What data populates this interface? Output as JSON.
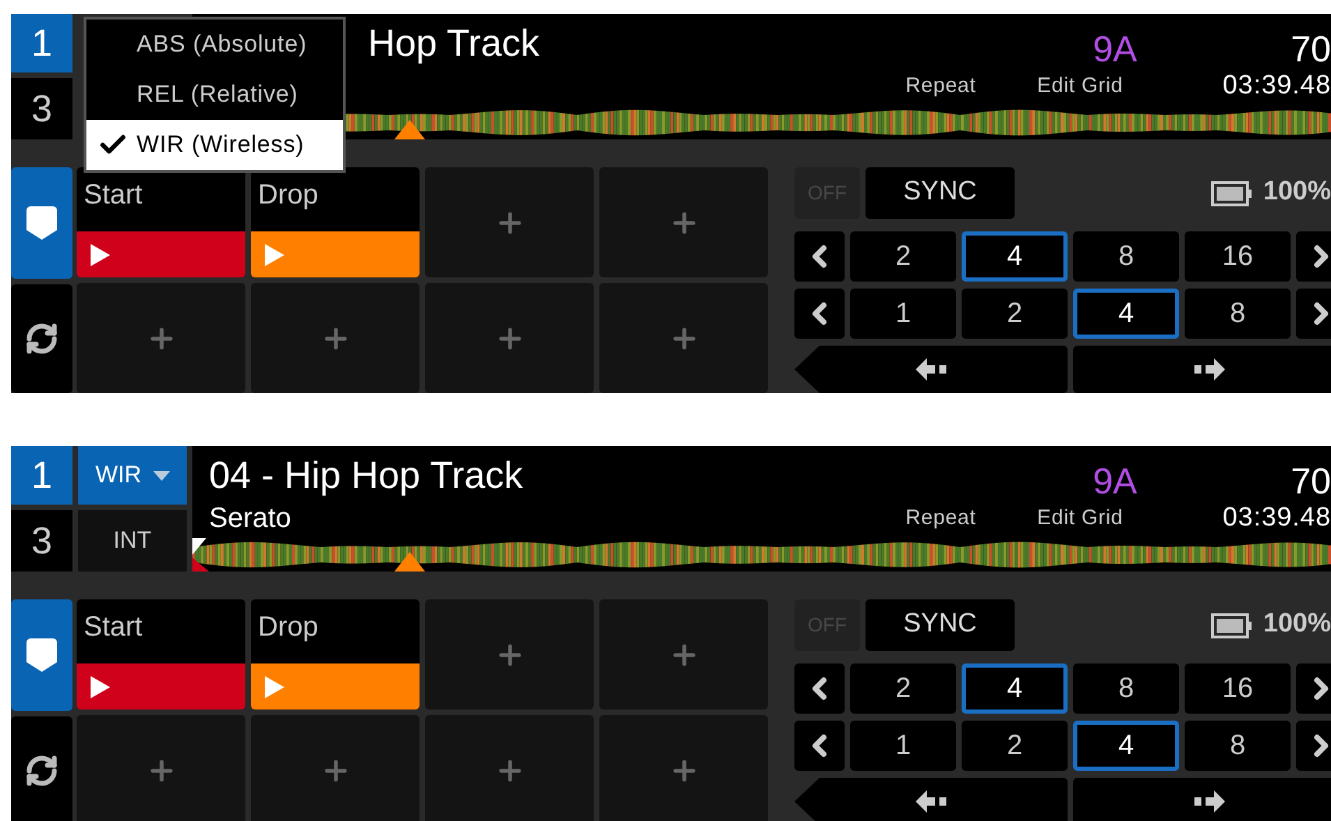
{
  "panels": [
    {
      "deck_buttons": [
        {
          "label": "1",
          "selected": true
        },
        {
          "label": "3",
          "selected": false
        }
      ],
      "mode_menu": {
        "items": [
          {
            "label": "ABS (Absolute)",
            "selected": false
          },
          {
            "label": "REL (Relative)",
            "selected": false
          },
          {
            "label": "WIR (Wireless)",
            "selected": true
          }
        ]
      },
      "track": {
        "title": "Hop Track",
        "key": "9A",
        "bpm": "70",
        "time": "03:39.48"
      },
      "actions": [
        "Repeat",
        "Edit Grid"
      ],
      "side_buttons": [
        {
          "kind": "cue",
          "selected": true
        },
        {
          "kind": "loop",
          "selected": false
        }
      ],
      "pads": [
        {
          "kind": "cue",
          "label": "Start",
          "color": "#d0021b"
        },
        {
          "kind": "cue",
          "label": "Drop",
          "color": "#ff7f00"
        },
        {
          "kind": "empty"
        },
        {
          "kind": "empty"
        },
        {
          "kind": "empty"
        },
        {
          "kind": "empty"
        },
        {
          "kind": "empty"
        },
        {
          "kind": "empty"
        }
      ],
      "sync": {
        "off_label": "OFF",
        "label": "SYNC"
      },
      "battery": {
        "reading": "100%"
      },
      "loop_rows": [
        {
          "values": [
            {
              "label": "2",
              "selected": false
            },
            {
              "label": "4",
              "selected": true
            },
            {
              "label": "8",
              "selected": false
            },
            {
              "label": "16",
              "selected": false
            }
          ]
        },
        {
          "values": [
            {
              "label": "1",
              "selected": false
            },
            {
              "label": "2",
              "selected": false
            },
            {
              "label": "4",
              "selected": true
            },
            {
              "label": "8",
              "selected": false
            }
          ]
        }
      ]
    },
    {
      "deck_buttons": [
        {
          "label": "1",
          "selected": true
        },
        {
          "label": "3",
          "selected": false
        }
      ],
      "mode_button": {
        "label": "WIR"
      },
      "input_button": {
        "label": "INT"
      },
      "track": {
        "title": "04 - Hip Hop Track",
        "artist": "Serato",
        "key": "9A",
        "bpm": "70",
        "time": "03:39.48"
      },
      "actions": [
        "Repeat",
        "Edit Grid"
      ],
      "side_buttons": [
        {
          "kind": "cue",
          "selected": true
        },
        {
          "kind": "loop",
          "selected": false
        }
      ],
      "pads": [
        {
          "kind": "cue",
          "label": "Start",
          "color": "#d0021b"
        },
        {
          "kind": "cue",
          "label": "Drop",
          "color": "#ff7f00"
        },
        {
          "kind": "empty"
        },
        {
          "kind": "empty"
        },
        {
          "kind": "empty"
        },
        {
          "kind": "empty"
        },
        {
          "kind": "empty"
        },
        {
          "kind": "empty"
        }
      ],
      "sync": {
        "off_label": "OFF",
        "label": "SYNC"
      },
      "battery": {
        "reading": "100%"
      },
      "loop_rows": [
        {
          "values": [
            {
              "label": "2",
              "selected": false
            },
            {
              "label": "4",
              "selected": true
            },
            {
              "label": "8",
              "selected": false
            },
            {
              "label": "16",
              "selected": false
            }
          ]
        },
        {
          "values": [
            {
              "label": "1",
              "selected": false
            },
            {
              "label": "2",
              "selected": false
            },
            {
              "label": "4",
              "selected": true
            },
            {
              "label": "8",
              "selected": false
            }
          ]
        }
      ]
    }
  ]
}
